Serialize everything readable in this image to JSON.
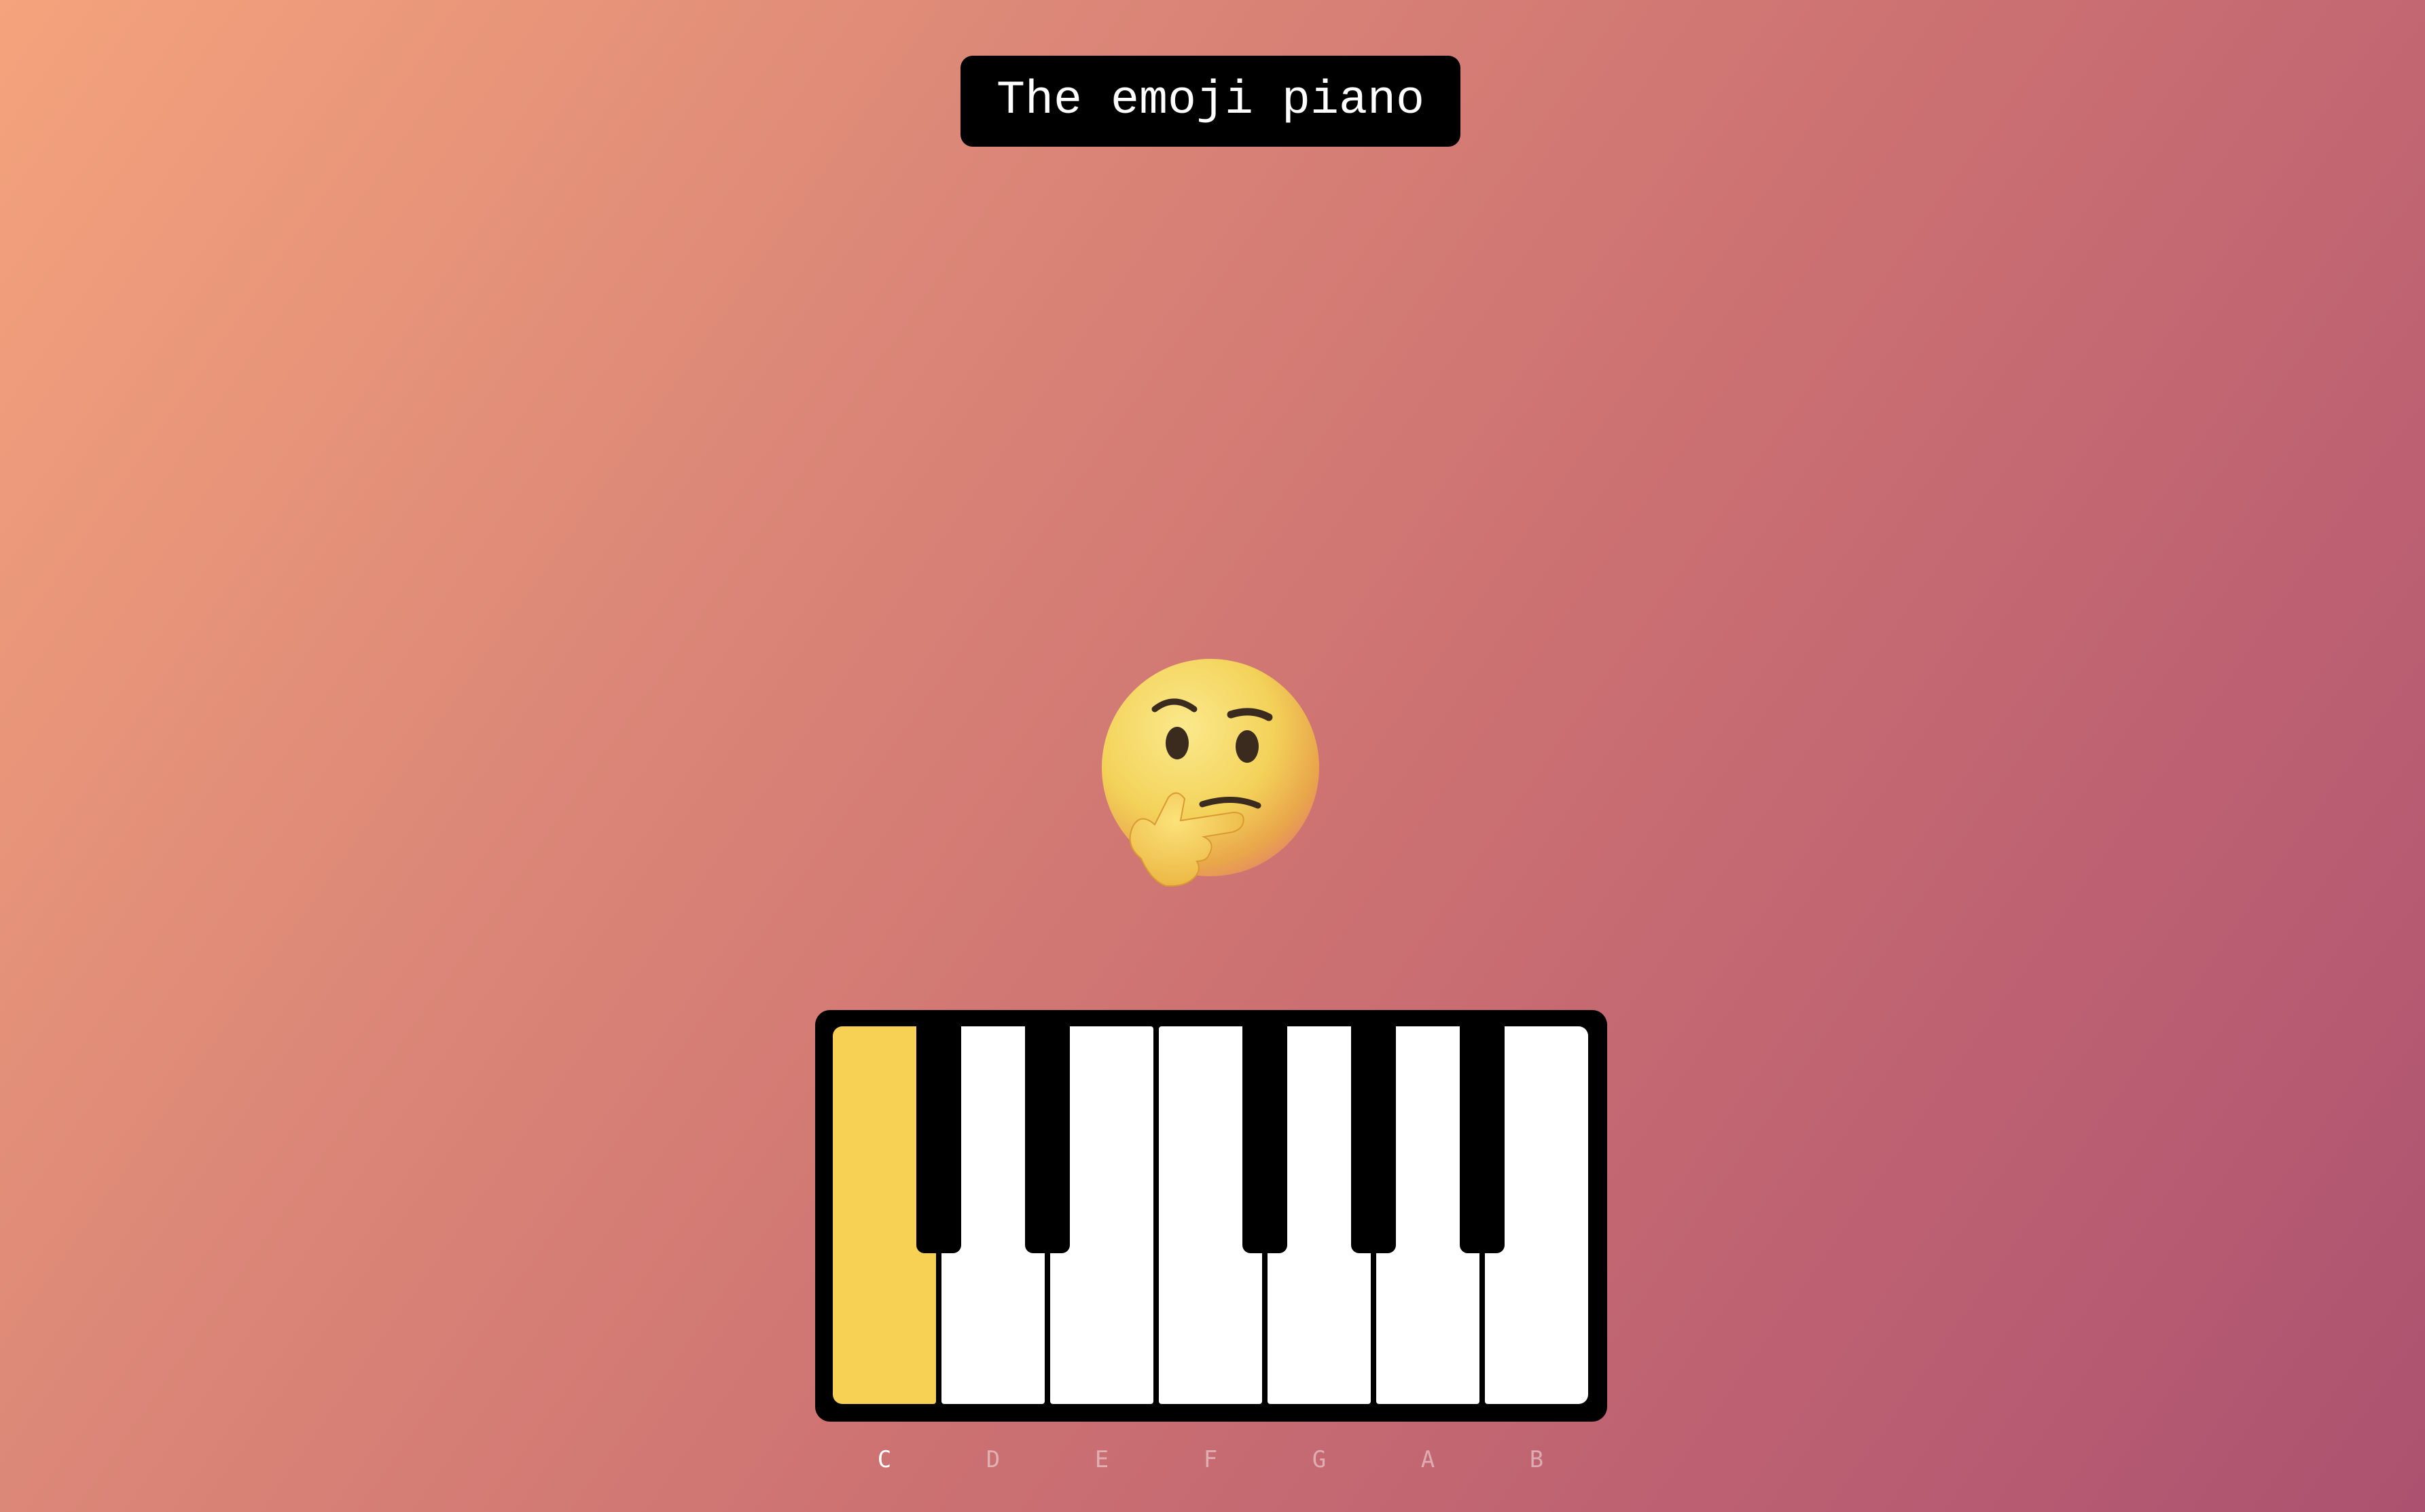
{
  "header": {
    "title": "The emoji piano"
  },
  "emoji": {
    "icon": "thinking-face",
    "colors": {
      "face": "#f6d55a",
      "face_shadow": "#e8a64a",
      "features": "#3b2a1e",
      "hand": "#f4c946"
    }
  },
  "piano": {
    "active_note": "C",
    "active_color": "#f7d154",
    "white_keys": [
      {
        "note": "C",
        "active": true
      },
      {
        "note": "D",
        "active": false
      },
      {
        "note": "E",
        "active": false
      },
      {
        "note": "F",
        "active": false
      },
      {
        "note": "G",
        "active": false
      },
      {
        "note": "A",
        "active": false
      },
      {
        "note": "B",
        "active": false
      }
    ],
    "black_keys": [
      {
        "after": "C"
      },
      {
        "after": "D"
      },
      {
        "after": "F"
      },
      {
        "after": "G"
      },
      {
        "after": "A"
      }
    ]
  },
  "labels": [
    "C",
    "D",
    "E",
    "F",
    "G",
    "A",
    "B"
  ]
}
